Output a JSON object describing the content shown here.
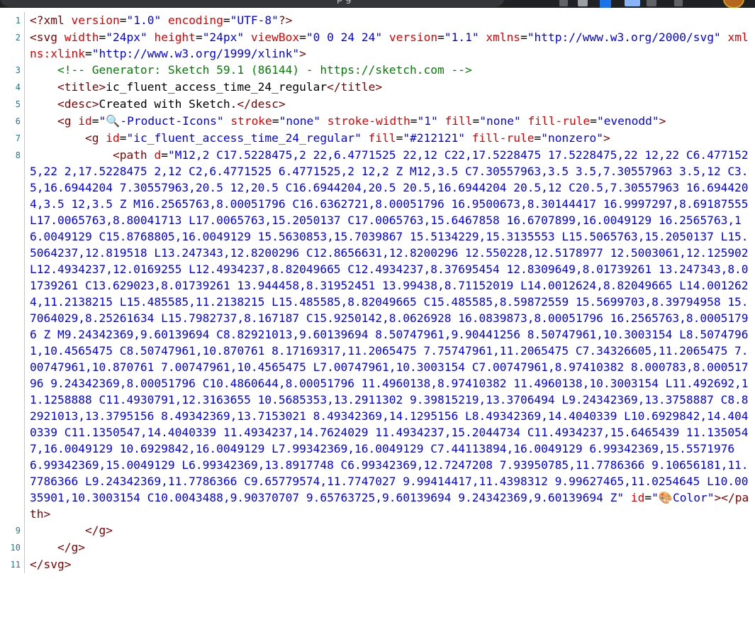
{
  "browser": {
    "tab_fragment": "p         g"
  },
  "lines": [
    {
      "no": "1",
      "indent": "",
      "tokens": [
        {
          "t": "tag",
          "v": "<?xml"
        },
        {
          "t": "plain",
          "v": " "
        },
        {
          "t": "attr",
          "v": "version"
        },
        {
          "t": "plain",
          "v": "="
        },
        {
          "t": "val",
          "v": "\"1.0\""
        },
        {
          "t": "plain",
          "v": " "
        },
        {
          "t": "attr",
          "v": "encoding"
        },
        {
          "t": "plain",
          "v": "="
        },
        {
          "t": "val",
          "v": "\"UTF-8\""
        },
        {
          "t": "tag",
          "v": "?>"
        }
      ]
    },
    {
      "no": "2",
      "indent": "",
      "tokens": [
        {
          "t": "tag",
          "v": "<svg"
        },
        {
          "t": "plain",
          "v": " "
        },
        {
          "t": "attr",
          "v": "width"
        },
        {
          "t": "plain",
          "v": "="
        },
        {
          "t": "val",
          "v": "\"24px\""
        },
        {
          "t": "plain",
          "v": " "
        },
        {
          "t": "attr",
          "v": "height"
        },
        {
          "t": "plain",
          "v": "="
        },
        {
          "t": "val",
          "v": "\"24px\""
        },
        {
          "t": "plain",
          "v": " "
        },
        {
          "t": "attr",
          "v": "viewBox"
        },
        {
          "t": "plain",
          "v": "="
        },
        {
          "t": "val",
          "v": "\"0 0 24 24\""
        },
        {
          "t": "plain",
          "v": " "
        },
        {
          "t": "attr",
          "v": "version"
        },
        {
          "t": "plain",
          "v": "="
        },
        {
          "t": "val",
          "v": "\"1.1\""
        },
        {
          "t": "plain",
          "v": " "
        },
        {
          "t": "attr",
          "v": "xmlns"
        },
        {
          "t": "plain",
          "v": "="
        },
        {
          "t": "val",
          "v": "\"http://www.w3.org/2000/svg\""
        },
        {
          "t": "plain",
          "v": " "
        },
        {
          "t": "attr",
          "v": "xmlns:xlink"
        },
        {
          "t": "plain",
          "v": "="
        },
        {
          "t": "val",
          "v": "\"http://www.w3.org/1999/xlink\""
        },
        {
          "t": "tag",
          "v": ">"
        }
      ]
    },
    {
      "no": "3",
      "indent": "    ",
      "tokens": [
        {
          "t": "cmt",
          "v": "<!-- Generator: Sketch 59.1 (86144) - https://sketch.com -->"
        }
      ]
    },
    {
      "no": "4",
      "indent": "    ",
      "tokens": [
        {
          "t": "tag",
          "v": "<title>"
        },
        {
          "t": "plain",
          "v": "ic_fluent_access_time_24_regular"
        },
        {
          "t": "tag",
          "v": "</title>"
        }
      ]
    },
    {
      "no": "5",
      "indent": "    ",
      "tokens": [
        {
          "t": "tag",
          "v": "<desc>"
        },
        {
          "t": "plain",
          "v": "Created with Sketch."
        },
        {
          "t": "tag",
          "v": "</desc>"
        }
      ]
    },
    {
      "no": "6",
      "indent": "    ",
      "tokens": [
        {
          "t": "tag",
          "v": "<g"
        },
        {
          "t": "plain",
          "v": " "
        },
        {
          "t": "attr",
          "v": "id"
        },
        {
          "t": "plain",
          "v": "="
        },
        {
          "t": "val",
          "v": "\"🔍-Product-Icons\""
        },
        {
          "t": "plain",
          "v": " "
        },
        {
          "t": "attr",
          "v": "stroke"
        },
        {
          "t": "plain",
          "v": "="
        },
        {
          "t": "val",
          "v": "\"none\""
        },
        {
          "t": "plain",
          "v": " "
        },
        {
          "t": "attr",
          "v": "stroke-width"
        },
        {
          "t": "plain",
          "v": "="
        },
        {
          "t": "val",
          "v": "\"1\""
        },
        {
          "t": "plain",
          "v": " "
        },
        {
          "t": "attr",
          "v": "fill"
        },
        {
          "t": "plain",
          "v": "="
        },
        {
          "t": "val",
          "v": "\"none\""
        },
        {
          "t": "plain",
          "v": " "
        },
        {
          "t": "attr",
          "v": "fill-rule"
        },
        {
          "t": "plain",
          "v": "="
        },
        {
          "t": "val",
          "v": "\"evenodd\""
        },
        {
          "t": "tag",
          "v": ">"
        }
      ]
    },
    {
      "no": "7",
      "indent": "        ",
      "tokens": [
        {
          "t": "tag",
          "v": "<g"
        },
        {
          "t": "plain",
          "v": " "
        },
        {
          "t": "attr",
          "v": "id"
        },
        {
          "t": "plain",
          "v": "="
        },
        {
          "t": "val",
          "v": "\"ic_fluent_access_time_24_regular\""
        },
        {
          "t": "plain",
          "v": " "
        },
        {
          "t": "attr",
          "v": "fill"
        },
        {
          "t": "plain",
          "v": "="
        },
        {
          "t": "val",
          "v": "\"#212121\""
        },
        {
          "t": "plain",
          "v": " "
        },
        {
          "t": "attr",
          "v": "fill-rule"
        },
        {
          "t": "plain",
          "v": "="
        },
        {
          "t": "val",
          "v": "\"nonzero\""
        },
        {
          "t": "tag",
          "v": ">"
        }
      ]
    },
    {
      "no": "8",
      "indent": "            ",
      "tokens": [
        {
          "t": "tag",
          "v": "<path"
        },
        {
          "t": "plain",
          "v": " "
        },
        {
          "t": "attr",
          "v": "d"
        },
        {
          "t": "plain",
          "v": "="
        },
        {
          "t": "val",
          "v": "\"M12,2 C17.5228475,2 22,6.4771525 22,12 C22,17.5228475 17.5228475,22 12,22 C6.4771525,22 2,17.5228475 2,12 C2,6.4771525 6.4771525,2 12,2 Z M12,3.5 C7.30557963,3.5 3.5,7.30557963 3.5,12 C3.5,16.6944204 7.30557963,20.5 12,20.5 C16.6944204,20.5 20.5,16.6944204 20.5,12 C20.5,7.30557963 16.6944204,3.5 12,3.5 Z M16.2565763,8.00051796 C16.6362721,8.00051796 16.9500673,8.30144417 16.9997297,8.69187555 L17.0065763,8.80041713 L17.0065763,15.2050137 C17.0065763,15.6467858 16.6707899,16.0049129 16.2565763,16.0049129 C15.8768805,16.0049129 15.5630853,15.7039867 15.5134229,15.3135553 L15.5065763,15.2050137 L15.5064237,12.819518 L13.247343,12.8200296 C12.8656631,12.8200296 12.550228,12.5178977 12.5003061,12.125902 L12.4934237,12.0169255 L12.4934237,8.82049665 C12.4934237,8.37695454 12.8309649,8.01739261 13.247343,8.01739261 C13.629023,8.01739261 13.944458,8.31952451 13.99438,8.71152019 L14.0012624,8.82049665 L14.0012624,11.2138215 L15.485585,11.2138215 L15.485585,8.82049665 C15.485585,8.59872559 15.5699703,8.39794958 15.7064029,8.25261634 L15.7982737,8.167187 C15.9250142,8.0626928 16.0839873,8.00051796 16.2565763,8.00051796 Z M9.24342369,9.60139694 C8.82921013,9.60139694 8.50747961,9.90441256 8.50747961,10.3003154 L8.50747961,10.4565475 C8.50747961,10.870761 8.17169317,11.2065475 7.75747961,11.2065475 C7.34326605,11.2065475 7.00747961,10.870761 7.00747961,10.4565475 L7.00747961,10.3003154 C7.00747961,8.97410382 8.000783,8.00051796 9.24342369,8.00051796 C10.4860644,8.00051796 11.4960138,8.97410382 11.4960138,10.3003154 L11.492692,11.1258888 C11.4930791,12.3163655 10.5685353,13.2911302 9.39815219,13.3706494 L9.24342369,13.3758887 C8.82921013,13.3795156 8.49342369,13.7153021 8.49342369,14.1295156 L8.49342369,14.4040339 L10.6929842,14.4040339 C11.1350547,14.4040339 11.4934237,14.7624029 11.4934237,15.2044734 C11.4934237,15.6465439 11.1350547,16.0049129 10.6929842,16.0049129 L7.99342369,16.0049129 C7.44113894,16.0049129 6.99342369,15.5571976 6.99342369,15.0049129 L6.99342369,13.8917748 C6.99342369,12.7247208 7.93950785,11.7786366 9.10656181,11.7786366 L9.24342369,11.7786366 C9.65779574,11.7747027 9.99414417,11.4398312 9.99627465,11.0254645 L10.0035901,10.3003154 C10.0043488,9.90370707 9.65763725,9.60139694 9.24342369,9.60139694 Z\""
        },
        {
          "t": "plain",
          "v": " "
        },
        {
          "t": "attr",
          "v": "id"
        },
        {
          "t": "plain",
          "v": "="
        },
        {
          "t": "val",
          "v": "\"🎨Color\""
        },
        {
          "t": "tag",
          "v": "></path>"
        }
      ]
    },
    {
      "no": "9",
      "indent": "        ",
      "tokens": [
        {
          "t": "tag",
          "v": "</g>"
        }
      ]
    },
    {
      "no": "10",
      "indent": "    ",
      "tokens": [
        {
          "t": "tag",
          "v": "</g>"
        }
      ]
    },
    {
      "no": "11",
      "indent": "",
      "tokens": [
        {
          "t": "tag",
          "v": "</svg>"
        }
      ]
    }
  ],
  "colors": {
    "tag": "#800000",
    "attr": "#e50000",
    "val": "#0000ff",
    "comment": "#008000",
    "line_number": "#237893"
  }
}
